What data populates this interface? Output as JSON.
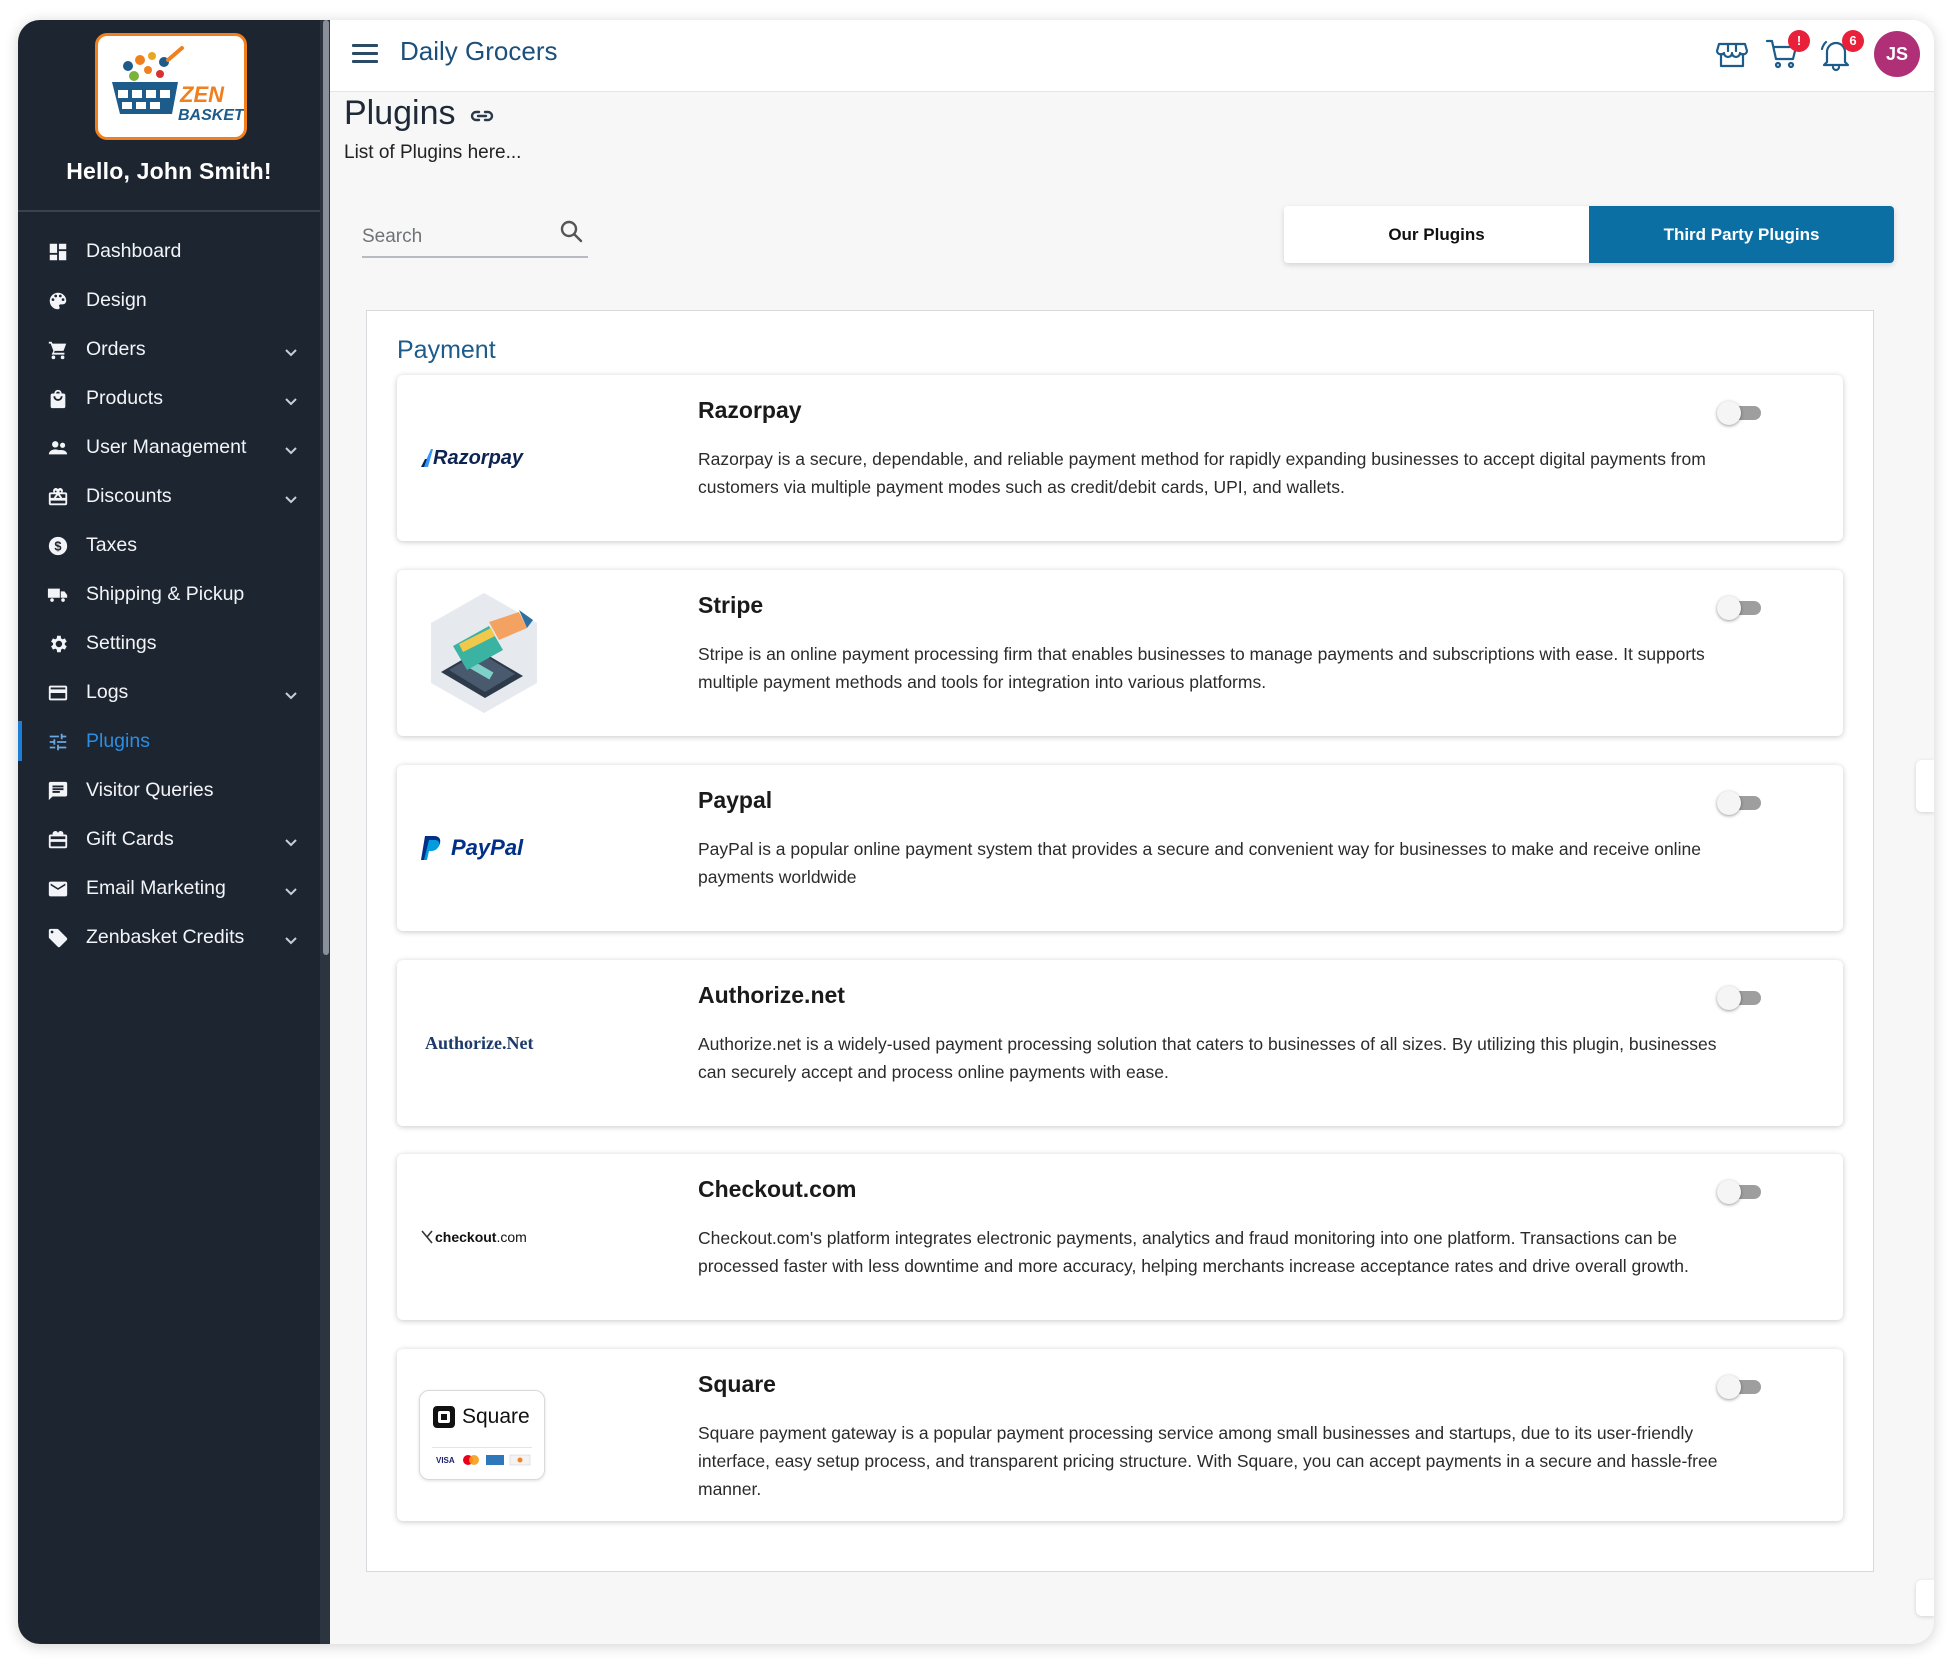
{
  "greeting": "Hello, John Smith!",
  "logo": {
    "text_top": "ZEN",
    "text_bottom": "BASKET"
  },
  "store_name": "Daily Grocers",
  "topbar": {
    "cart_badge": "!",
    "notif_badge": "6",
    "avatar_initials": "JS"
  },
  "menu": [
    {
      "label": "Dashboard",
      "icon": "dashboard-icon",
      "chevron": false
    },
    {
      "label": "Design",
      "icon": "palette-icon",
      "chevron": false
    },
    {
      "label": "Orders",
      "icon": "cart-icon",
      "chevron": true
    },
    {
      "label": "Products",
      "icon": "bag-icon",
      "chevron": true
    },
    {
      "label": "User Management",
      "icon": "users-icon",
      "chevron": true
    },
    {
      "label": "Discounts",
      "icon": "gift-icon",
      "chevron": true
    },
    {
      "label": "Taxes",
      "icon": "dollar-icon",
      "chevron": false
    },
    {
      "label": "Shipping & Pickup",
      "icon": "truck-icon",
      "chevron": false
    },
    {
      "label": "Settings",
      "icon": "gear-icon",
      "chevron": false
    },
    {
      "label": "Logs",
      "icon": "card-icon",
      "chevron": true
    },
    {
      "label": "Plugins",
      "icon": "sliders-icon",
      "chevron": false,
      "active": true
    },
    {
      "label": "Visitor Queries",
      "icon": "message-icon",
      "chevron": false
    },
    {
      "label": "Gift Cards",
      "icon": "giftcard-icon",
      "chevron": true
    },
    {
      "label": "Email Marketing",
      "icon": "mail-icon",
      "chevron": true
    },
    {
      "label": "Zenbasket Credits",
      "icon": "tag-icon",
      "chevron": true
    }
  ],
  "page": {
    "title": "Plugins",
    "subtitle": "List of Plugins here...",
    "search_placeholder": "Search"
  },
  "tabs": {
    "our": "Our Plugins",
    "third_party": "Third Party Plugins",
    "active": "third_party"
  },
  "section_title": "Payment",
  "plugins": [
    {
      "name": "Razorpay",
      "logo_text": "Razorpay",
      "enabled": false,
      "description": "Razorpay is a secure, dependable, and reliable payment method for rapidly expanding businesses to accept digital payments from customers via multiple payment modes such as credit/debit cards, UPI, and wallets."
    },
    {
      "name": "Stripe",
      "logo_text": "",
      "enabled": false,
      "description": "Stripe is an online payment processing firm that enables businesses to manage payments and subscriptions with ease. It supports multiple payment methods and tools for integration into various platforms."
    },
    {
      "name": "Paypal",
      "logo_text": "PayPal",
      "enabled": false,
      "description": "PayPal is a popular online payment system that provides a secure and convenient way for businesses to make and receive online payments worldwide"
    },
    {
      "name": "Authorize.net",
      "logo_text": "Authorize.Net",
      "enabled": false,
      "description": "Authorize.net is a widely-used payment processing solution that caters to businesses of all sizes. By utilizing this plugin, businesses can securely accept and process online payments with ease."
    },
    {
      "name": "Checkout.com",
      "logo_text": "checkout",
      "logo_suffix": ".com",
      "enabled": false,
      "description": "Checkout.com's platform integrates electronic payments, analytics and fraud monitoring into one platform. Transactions can be processed faster with less downtime and more accuracy, helping merchants increase acceptance rates and drive overall growth."
    },
    {
      "name": "Square",
      "logo_text": "Square",
      "enabled": false,
      "description": "Square payment gateway is a popular payment processing service among small businesses and startups, due to its user-friendly interface, easy setup process, and transparent pricing structure. With Square, you can accept payments in a secure and hassle-free manner."
    }
  ],
  "colors": {
    "sidebar_bg": "#1d2530",
    "accent": "#0b6fa4",
    "active_menu": "#2d8de0",
    "brand_orange": "#f07f1e"
  }
}
